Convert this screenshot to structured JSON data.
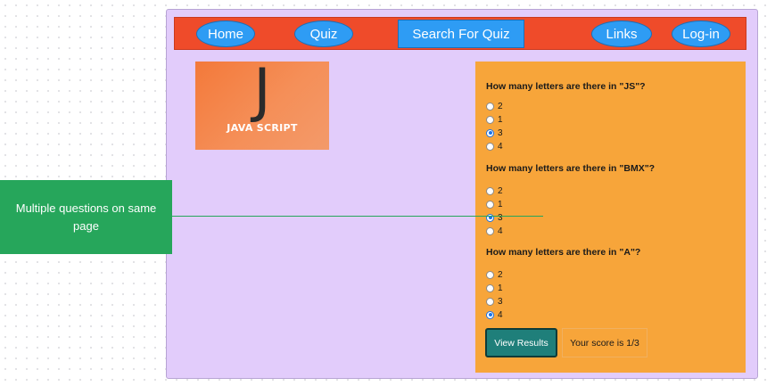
{
  "nav": {
    "home": "Home",
    "quiz": "Quiz",
    "search": "Search For Quiz",
    "links": "Links",
    "login": "Log-in"
  },
  "logo": {
    "letter": "J",
    "text": "JAVA SCRIPT"
  },
  "questions": [
    {
      "text": "How many letters are there in \"JS\"?",
      "options": [
        "2",
        "1",
        "3",
        "4"
      ],
      "selected": "3"
    },
    {
      "text": "How many letters are there in \"BMX\"?",
      "options": [
        "2",
        "1",
        "3",
        "4"
      ],
      "selected": "3"
    },
    {
      "text": "How many letters are there in \"A\"?",
      "options": [
        "2",
        "1",
        "3",
        "4"
      ],
      "selected": "4"
    }
  ],
  "results": {
    "button": "View Results",
    "score": "Your score is 1/3"
  },
  "annotation": "Multiple questions on same page",
  "colors": {
    "page_bg": "#e2ccfb",
    "navbar": "#ef4b2a",
    "nav_button": "#2e9cf4",
    "quiz_panel": "#f7a53a",
    "view_button": "#1f7f7a",
    "annotation": "#26a65b"
  }
}
